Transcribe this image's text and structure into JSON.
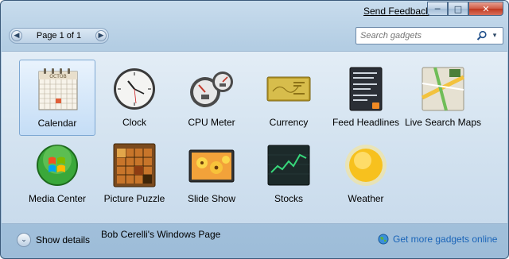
{
  "titlebar": {
    "send_feedback": "Send Feedback",
    "minimize_glyph": "─",
    "maximize_glyph": "□",
    "close_glyph": "✕"
  },
  "pager": {
    "label": "Page 1 of 1",
    "prev_icon": "chevron-left-icon",
    "next_icon": "chevron-right-icon",
    "prev_glyph": "◀",
    "next_glyph": "▶"
  },
  "search": {
    "placeholder": "Search gadgets",
    "icon": "search-icon",
    "dropdown_glyph": "▾"
  },
  "gadgets": [
    {
      "label": "Calendar",
      "icon": "calendar-icon",
      "selected": true,
      "calendar_month": "OCTOB"
    },
    {
      "label": "Clock",
      "icon": "clock-icon"
    },
    {
      "label": "CPU Meter",
      "icon": "cpu-meter-icon"
    },
    {
      "label": "Currency",
      "icon": "currency-icon"
    },
    {
      "label": "Feed Headlines",
      "icon": "feed-headlines-icon"
    },
    {
      "label": "Live Search Maps",
      "icon": "map-icon"
    },
    {
      "label": "Media Center",
      "icon": "media-center-icon"
    },
    {
      "label": "Picture Puzzle",
      "icon": "picture-puzzle-icon"
    },
    {
      "label": "Slide Show",
      "icon": "slide-show-icon"
    },
    {
      "label": "Stocks",
      "icon": "stocks-icon"
    },
    {
      "label": "Weather",
      "icon": "weather-icon"
    }
  ],
  "footer": {
    "show_details": "Show details",
    "show_details_glyph": "⌄",
    "owner_text": "Bob Cerelli's Windows Page",
    "more_gadgets": "Get more gadgets online"
  },
  "colors": {
    "link": "#1a64b8",
    "selection": "#c4ddf6",
    "close_button": "#c0391f"
  }
}
